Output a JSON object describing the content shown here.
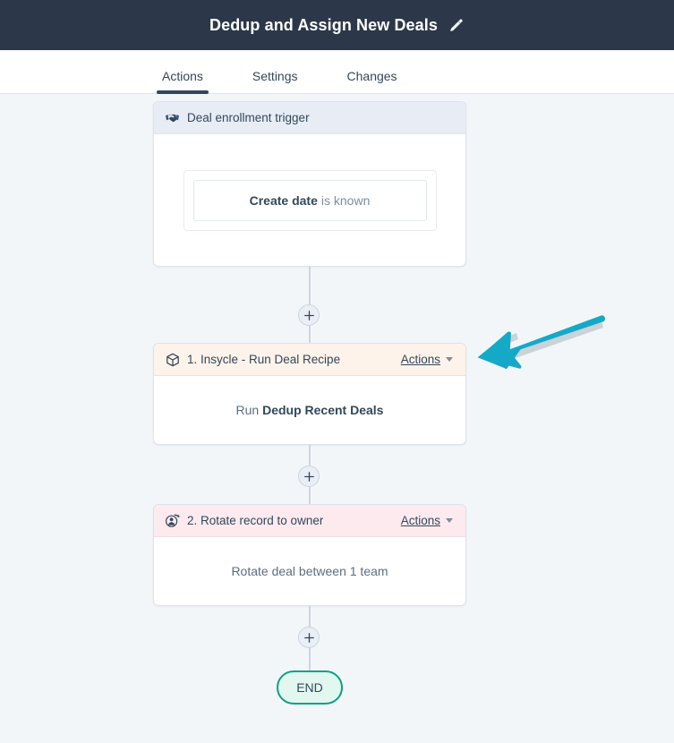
{
  "header": {
    "title": "Dedup and Assign New Deals",
    "edit_icon": "pencil-icon"
  },
  "tabs": [
    {
      "label": "Actions",
      "active": true
    },
    {
      "label": "Settings",
      "active": false
    },
    {
      "label": "Changes",
      "active": false
    }
  ],
  "workflow": {
    "trigger": {
      "icon": "handshake-icon",
      "header": "Deal enrollment trigger",
      "filter": {
        "property": "Create date",
        "operator": "is known"
      }
    },
    "steps": [
      {
        "icon": "cube-icon",
        "header": "1. Insycle - Run Deal Recipe",
        "actions_label": "Actions",
        "body_prefix": "Run",
        "body_strong": "Dedup Recent Deals"
      },
      {
        "icon": "rotate-owner-icon",
        "header": "2. Rotate record to owner",
        "actions_label": "Actions",
        "body_text": "Rotate deal between 1 team"
      }
    ],
    "end_label": "END",
    "add_step_label": "+"
  },
  "colors": {
    "topbar": "#2c3849",
    "canvas": "#f3f6f9",
    "trigger_header": "#e8edf5",
    "step1_header": "#fdf3ea",
    "step2_header": "#fceaee",
    "end_border": "#0ca184",
    "end_fill": "#e3f7f1",
    "annotation_arrow": "#15a9c8",
    "connector": "#cbd6e2"
  }
}
